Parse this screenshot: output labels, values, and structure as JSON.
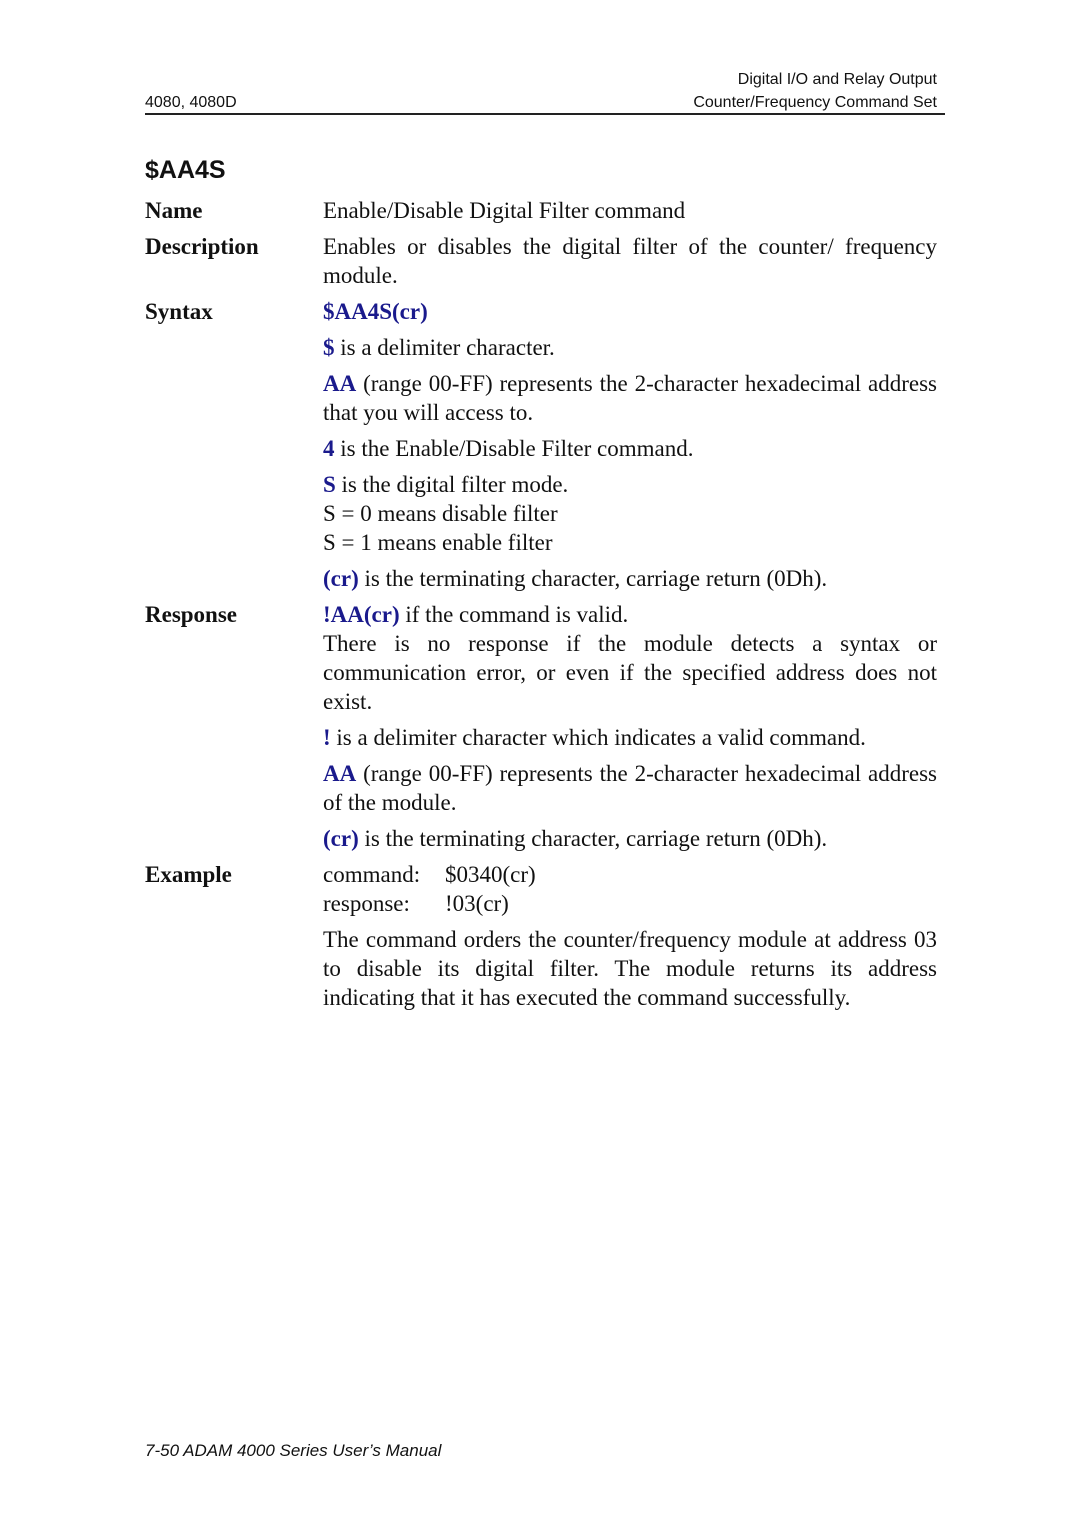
{
  "header": {
    "chapter_line": "Digital I/O and Relay Output",
    "models": "4080, 4080D",
    "section_line": "Counter/Frequency Command Set"
  },
  "section_title": "$AA4S",
  "colors": {
    "accent": "#1a1a8c",
    "text": "#111111"
  },
  "labels": {
    "name": "Name",
    "description": "Description",
    "syntax": "Syntax",
    "response": "Response",
    "example": "Example"
  },
  "name_text": "Enable/Disable Digital Filter command",
  "description_text": "Enables or disables the digital filter of the counter/ frequency module.",
  "syntax": {
    "command": "$AA4S(cr)",
    "items": [
      {
        "key": "$",
        "text": " is a delimiter character."
      },
      {
        "key": "AA",
        "text": " (range 00-FF) represents the 2-character hexadecimal address that you will access to."
      },
      {
        "key": "4",
        "text": " is the Enable/Disable Filter command."
      },
      {
        "key": "S",
        "text": " is the digital filter mode."
      },
      {
        "key": "(cr)",
        "text": " is the terminating character, carriage return (0Dh)."
      }
    ],
    "s_values": [
      "S = 0 means disable filter",
      "S = 1 means enable filter"
    ]
  },
  "response": {
    "valid_key": "!AA(cr)",
    "valid_text": " if the command is valid.",
    "no_response": "There is no response if the module detects a syntax or communication error, or even if the specified address does not exist.",
    "items": [
      {
        "key": "!",
        "text": " is a delimiter character which indicates a valid command."
      },
      {
        "key": "AA",
        "text": " (range 00-FF) represents the 2-character hexadecimal address of the module."
      },
      {
        "key": "(cr)",
        "text": " is the terminating character, carriage return (0Dh)."
      }
    ]
  },
  "example": {
    "command_label": "command:",
    "command_value": "$0340(cr)",
    "response_label": "response:",
    "response_value": "!03(cr)",
    "explanation": "The command orders the counter/frequency module at address 03 to disable its digital filter. The module returns its address indicating that it has executed the command successfully."
  },
  "footer": "7-50 ADAM 4000 Series User’s Manual"
}
